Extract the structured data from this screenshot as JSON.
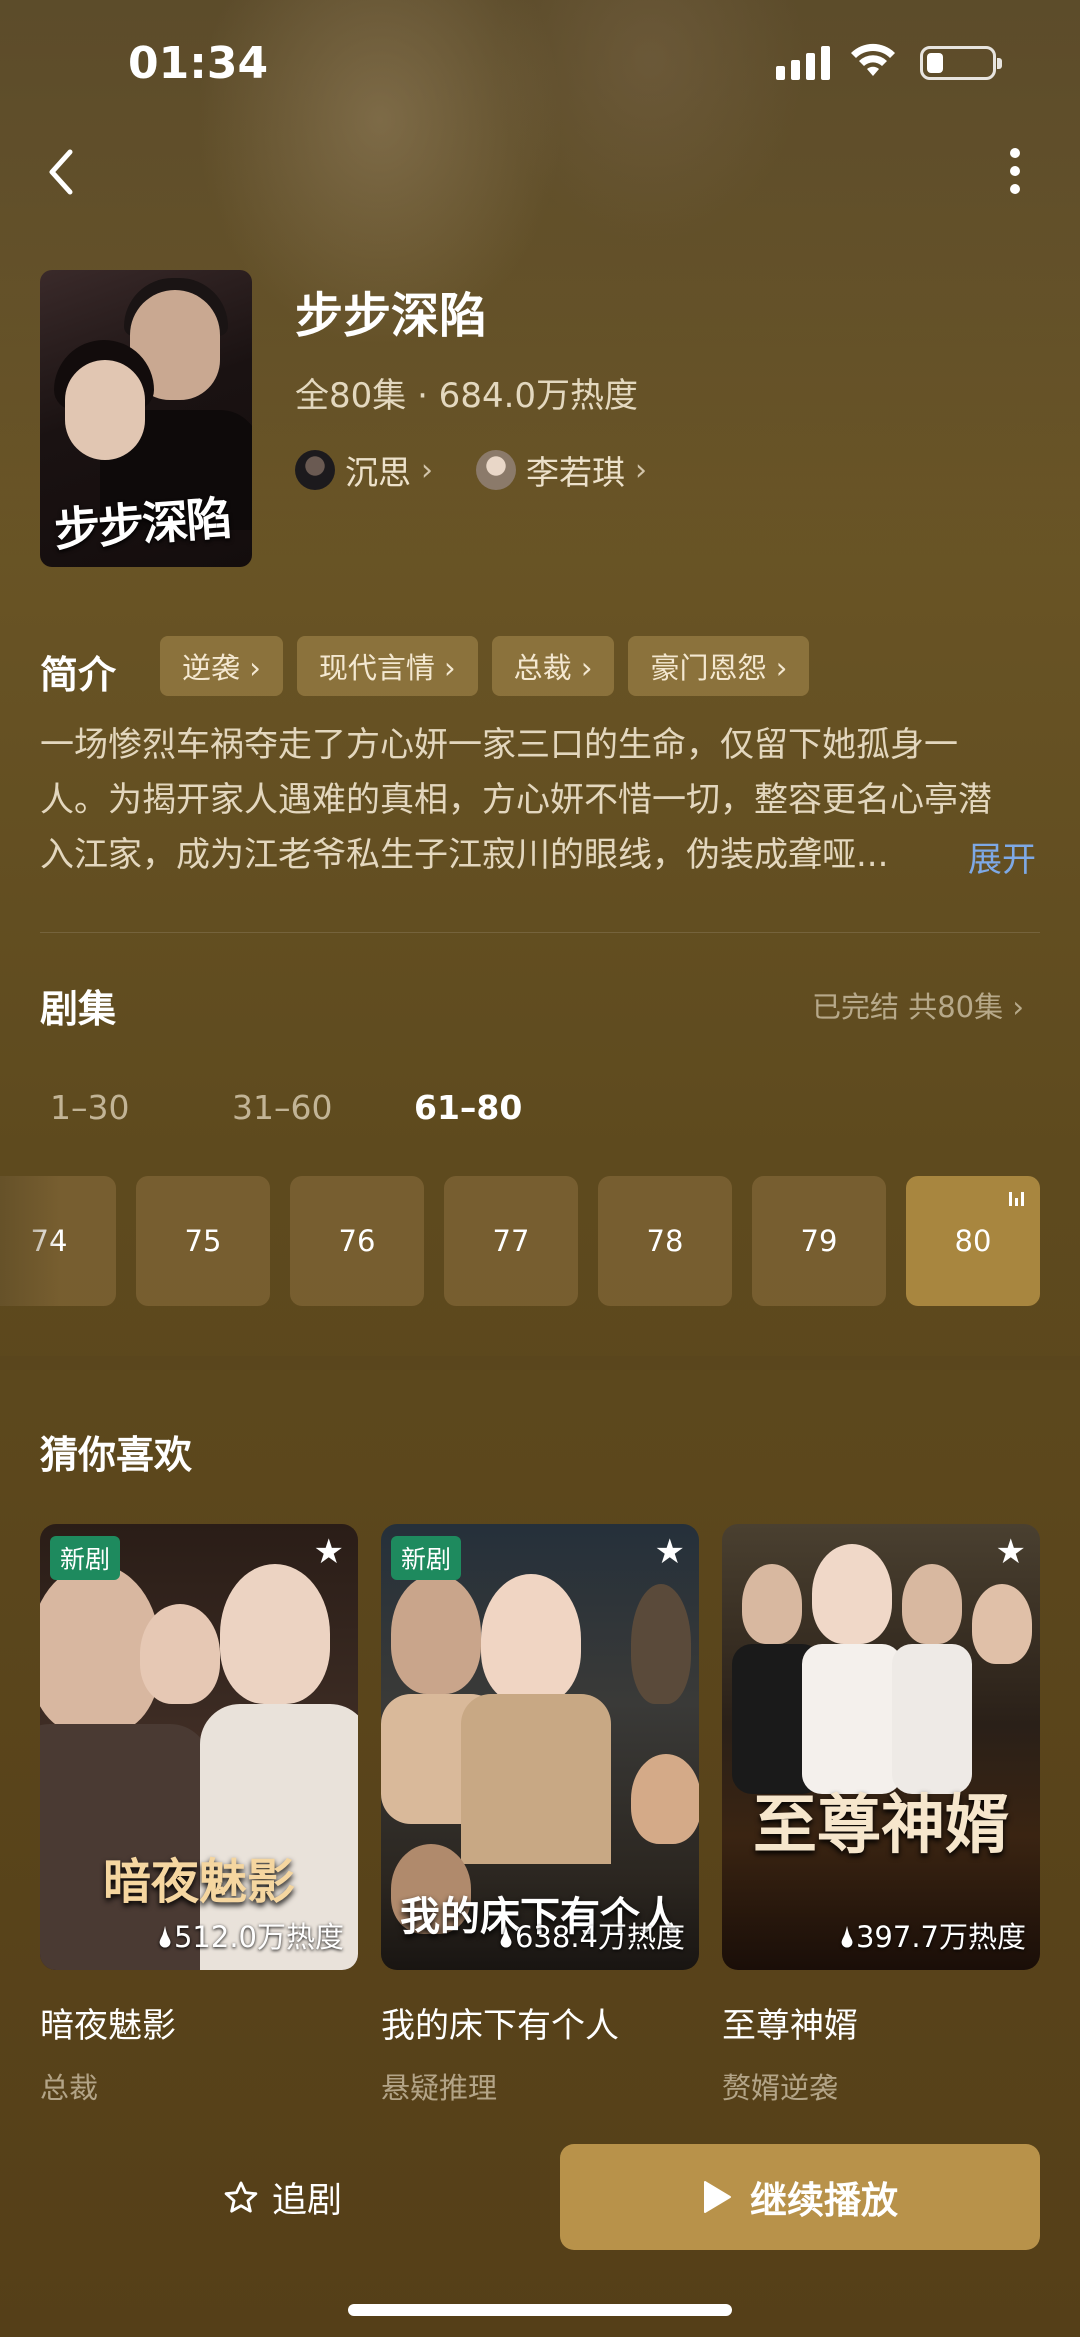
{
  "status": {
    "time": "01:34"
  },
  "drama": {
    "title": "步步深陷",
    "poster_title": "步步深陷",
    "meta": "全80集 · 684.0万热度",
    "actors": [
      {
        "name": "沉思",
        "chevron": "›"
      },
      {
        "name": "李若琪",
        "chevron": "›"
      }
    ]
  },
  "intro": {
    "label": "简介",
    "tags": [
      "逆袭 ›",
      "现代言情 ›",
      "总裁 ›",
      "豪门恩怨 ›"
    ],
    "lines": [
      "一场惨烈车祸夺走了方心妍一家三口的生命，仅留下她孤身一",
      "人。为揭开家人遇难的真相，方心妍不惜一切，整容更名心亭潜",
      "入江家，成为江老爷私生子江寂川的眼线，伪装成聋哑..."
    ],
    "expand": "展开"
  },
  "episodes": {
    "title": "剧集",
    "status": "已完结 共80集 ›",
    "ranges": [
      "1–30",
      "31–60",
      "61–80"
    ],
    "active_range": "61–80",
    "items": [
      "74",
      "75",
      "76",
      "77",
      "78",
      "79",
      "80"
    ],
    "current": "80"
  },
  "recommend": {
    "title": "猜你喜欢",
    "cards": [
      {
        "badge": "新剧",
        "overlay": "暗夜魅影",
        "heat": "512.0万热度",
        "name": "暗夜魅影",
        "genre": "总裁"
      },
      {
        "badge": "新剧",
        "overlay": "我的床下有个人",
        "heat": "638.4万热度",
        "name": "我的床下有个人",
        "genre": "悬疑推理"
      },
      {
        "badge": "",
        "overlay": "至尊神婿",
        "heat": "397.7万热度",
        "name": "至尊神婿",
        "genre": "赘婿逆袭"
      }
    ]
  },
  "bottom": {
    "follow_label": "追剧",
    "play_label": "继续播放"
  },
  "colors": {
    "accent": "#b8924a",
    "expand_link": "#7ea9e6",
    "new_badge": "#1e8a5e"
  },
  "icons": [
    "back-icon",
    "more-icon",
    "star-icon",
    "play-icon",
    "flame-icon"
  ]
}
